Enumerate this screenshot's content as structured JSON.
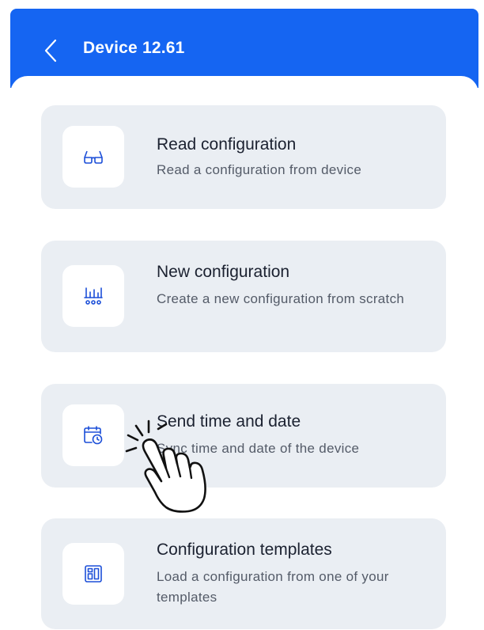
{
  "header": {
    "title": "Device 12.61",
    "back_icon": "chevron-left-icon",
    "background": "#1565f2"
  },
  "menu": {
    "items": [
      {
        "title": "Read configuration",
        "subtitle": "Read a configuration from device",
        "icon": "glasses-icon"
      },
      {
        "title": "New configuration",
        "subtitle": "Create a new configuration from scratch",
        "icon": "equalizer-icon"
      },
      {
        "title": "Send time and date",
        "subtitle": "Sync time and date of the device",
        "icon": "calendar-clock-icon"
      },
      {
        "title": "Configuration templates",
        "subtitle": "Load a configuration from one of your templates",
        "icon": "template-icon"
      }
    ]
  },
  "overlay": {
    "icon": "tap-hand-cursor-icon"
  },
  "colors": {
    "accent": "#1565f2",
    "card": "#eaeef3",
    "icon_stroke": "#1c4fd8"
  }
}
